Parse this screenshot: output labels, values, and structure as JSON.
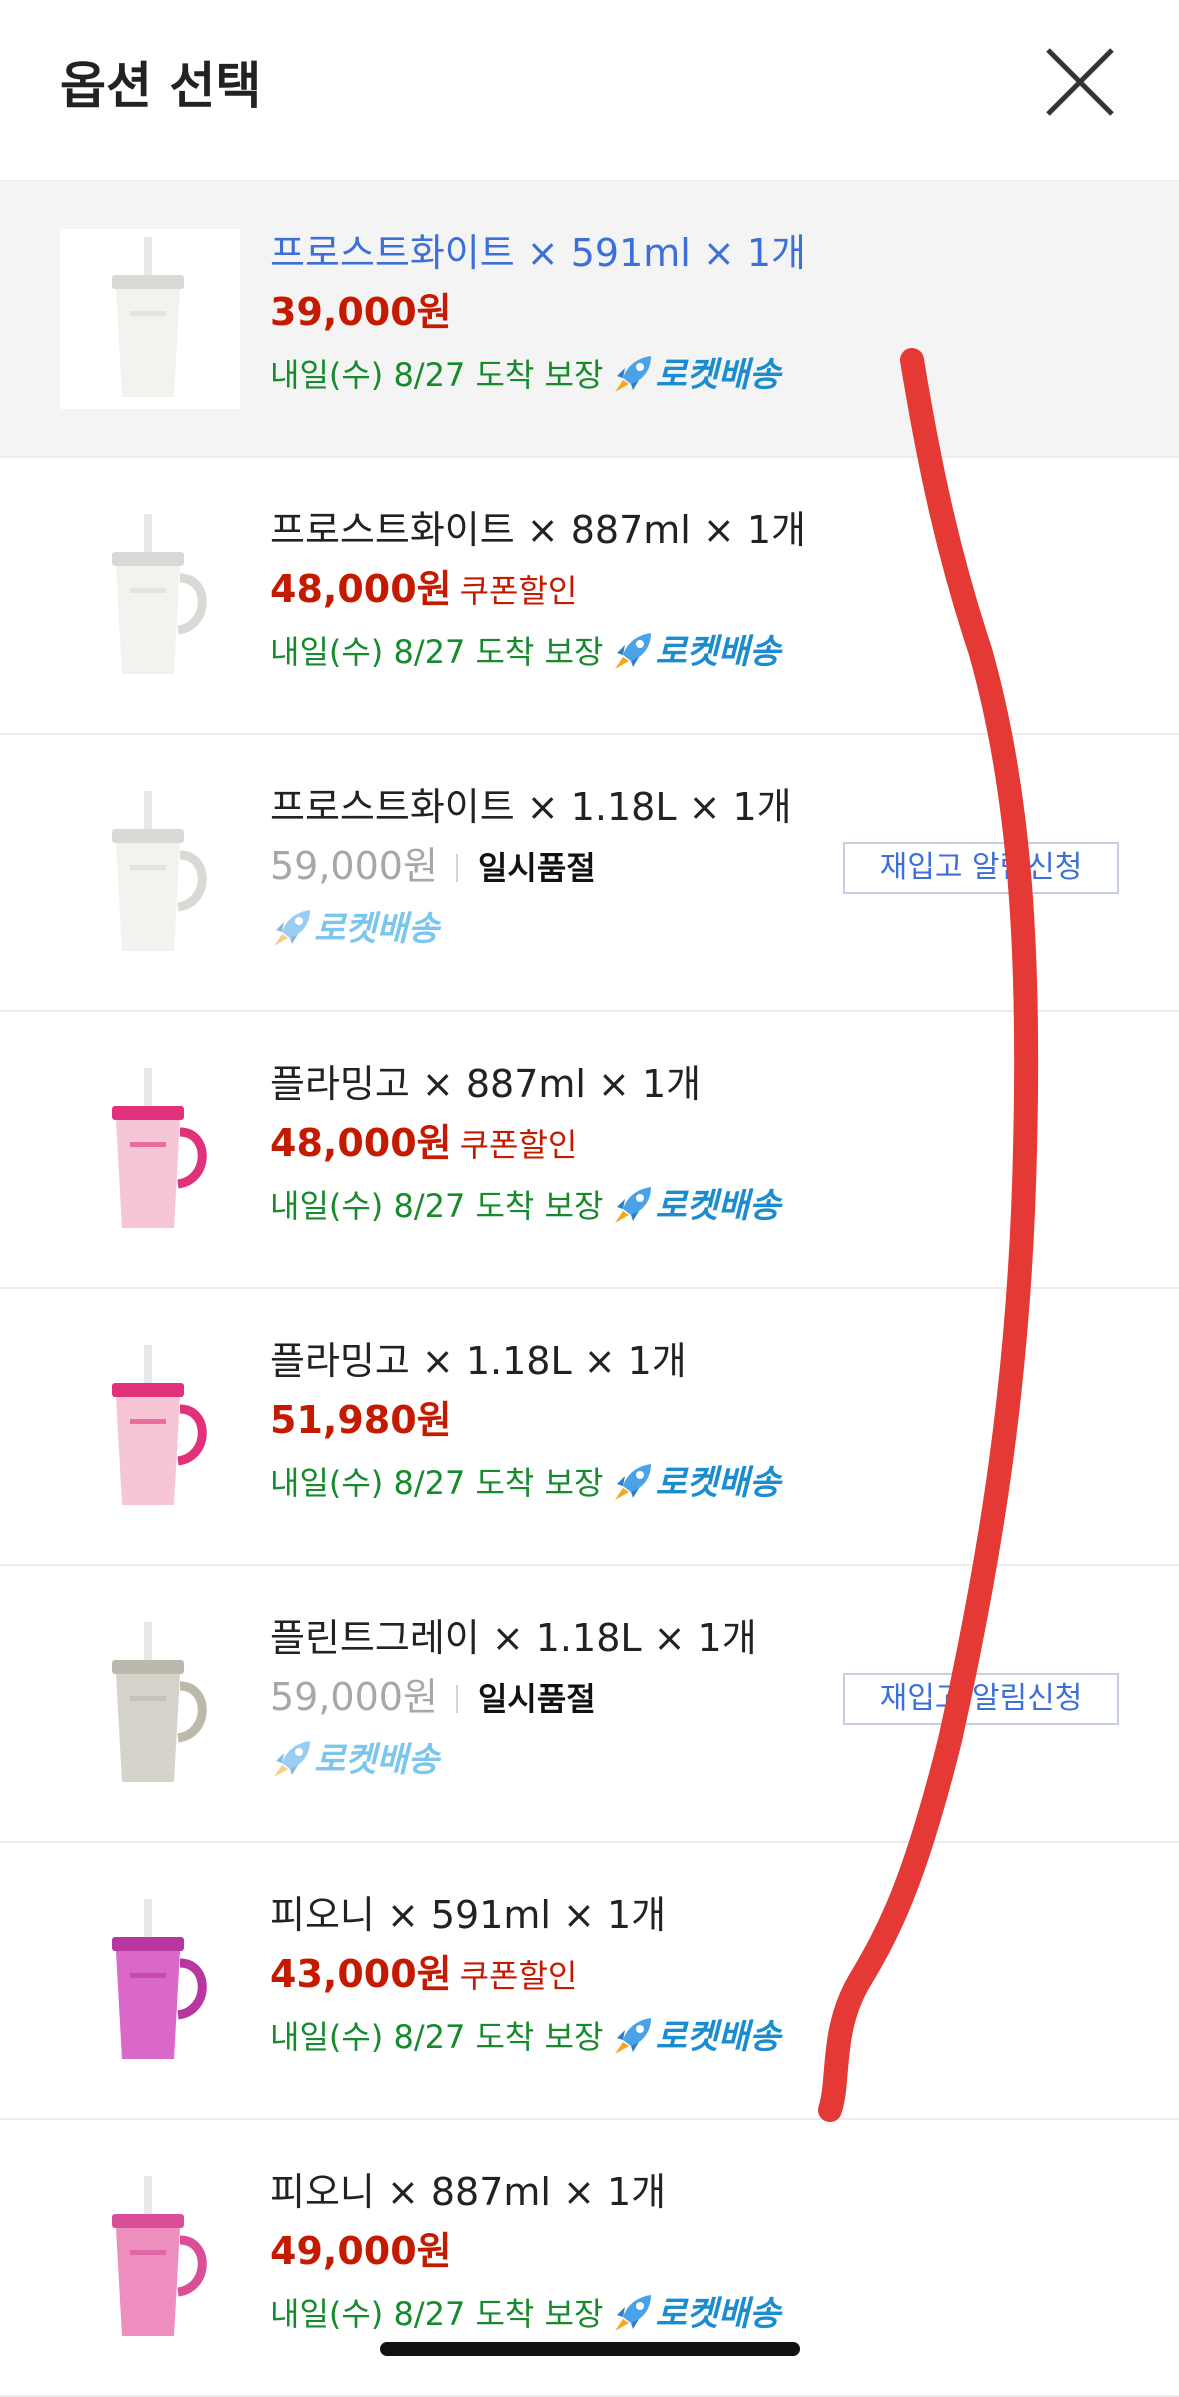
{
  "header": {
    "title": "옵션 선택",
    "close_icon": "close-icon"
  },
  "colors": {
    "price_red": "#c41a00",
    "selected_blue": "#3d6fd9",
    "delivery_green": "#168a2d",
    "rocket_blue": "#1a8ccf",
    "scribble_red": "#e53935"
  },
  "options": [
    {
      "name": "프로스트화이트 × 591ml × 1개",
      "price": "39,000원",
      "coupon": "",
      "soldout": "",
      "delivery": "내일(수) 8/27 도착 보장",
      "rocket": "로켓배송",
      "restock": "",
      "selected": true,
      "cup_color": "#f2f2ef",
      "accent_color": "#d9d9d6"
    },
    {
      "name": "프로스트화이트 × 887ml × 1개",
      "price": "48,000원",
      "coupon": "쿠폰할인",
      "soldout": "",
      "delivery": "내일(수) 8/27 도착 보장",
      "rocket": "로켓배송",
      "restock": "",
      "selected": false,
      "cup_color": "#f2f2ef",
      "accent_color": "#d9d9d6"
    },
    {
      "name": "프로스트화이트 × 1.18L × 1개",
      "price": "59,000원",
      "coupon": "",
      "soldout": "일시품절",
      "delivery": "",
      "rocket": "로켓배송",
      "restock": "재입고 알림신청",
      "selected": false,
      "cup_color": "#f2f2ef",
      "accent_color": "#d9d9d6"
    },
    {
      "name": "플라밍고 × 887ml × 1개",
      "price": "48,000원",
      "coupon": "쿠폰할인",
      "soldout": "",
      "delivery": "내일(수) 8/27 도착 보장",
      "rocket": "로켓배송",
      "restock": "",
      "selected": false,
      "cup_color": "#f7c6d6",
      "accent_color": "#e0317a"
    },
    {
      "name": "플라밍고 × 1.18L × 1개",
      "price": "51,980원",
      "coupon": "",
      "soldout": "",
      "delivery": "내일(수) 8/27 도착 보장",
      "rocket": "로켓배송",
      "restock": "",
      "selected": false,
      "cup_color": "#f7c6d6",
      "accent_color": "#e0317a"
    },
    {
      "name": "플린트그레이 × 1.18L × 1개",
      "price": "59,000원",
      "coupon": "",
      "soldout": "일시품절",
      "delivery": "",
      "rocket": "로켓배송",
      "restock": "재입고 알림신청",
      "selected": false,
      "cup_color": "#d6d3cb",
      "accent_color": "#bdb8ad"
    },
    {
      "name": "피오니 × 591ml × 1개",
      "price": "43,000원",
      "coupon": "쿠폰할인",
      "soldout": "",
      "delivery": "내일(수) 8/27 도착 보장",
      "rocket": "로켓배송",
      "restock": "",
      "selected": false,
      "cup_color": "#d968c8",
      "accent_color": "#b8369f"
    },
    {
      "name": "피오니 × 887ml × 1개",
      "price": "49,000원",
      "coupon": "",
      "soldout": "",
      "delivery": "내일(수) 8/27 도착 보장",
      "rocket": "로켓배송",
      "restock": "",
      "selected": false,
      "cup_color": "#ee8ebf",
      "accent_color": "#d94e96"
    }
  ]
}
